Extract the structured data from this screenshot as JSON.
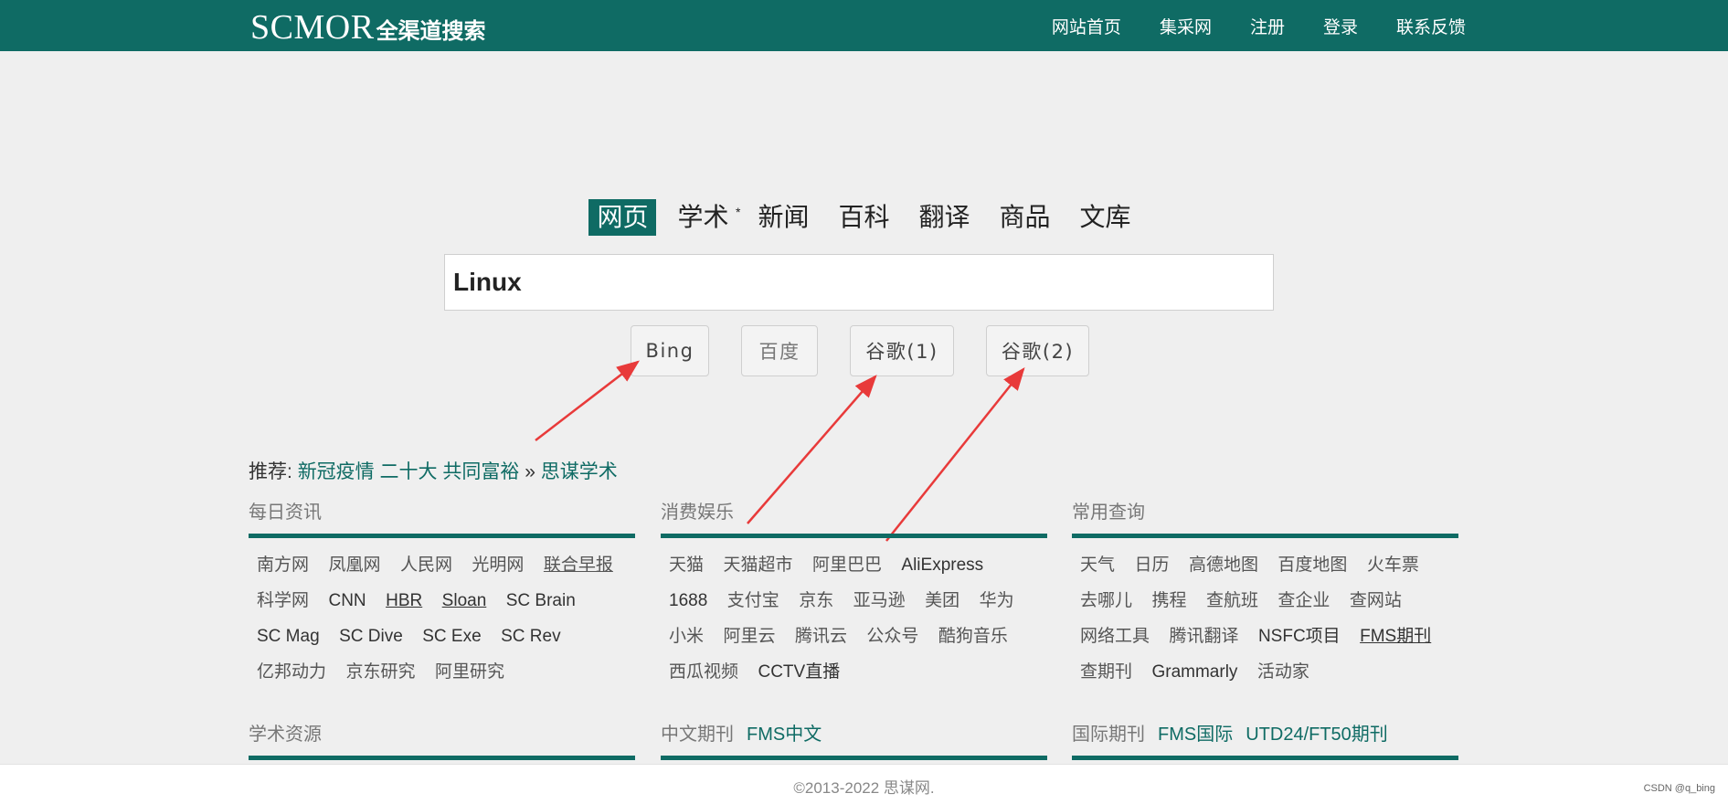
{
  "header": {
    "logo_en": "SCMOR",
    "logo_cn": "全渠道搜索",
    "nav": [
      "网站首页",
      "集采网",
      "注册",
      "登录",
      "联系反馈"
    ]
  },
  "tabs": [
    {
      "label": "网页",
      "active": true
    },
    {
      "label": "学术",
      "sup": "*"
    },
    {
      "label": "新闻"
    },
    {
      "label": "百科"
    },
    {
      "label": "翻译"
    },
    {
      "label": "商品"
    },
    {
      "label": "文库"
    }
  ],
  "search": {
    "value": "Linux"
  },
  "buttons": {
    "bing": "Bing",
    "baidu": "百度",
    "google1": "谷歌(1)",
    "google2": "谷歌(2)"
  },
  "recommend": {
    "prefix": "推荐:",
    "links": [
      "新冠疫情",
      "二十大",
      "共同富裕"
    ],
    "sep": "»",
    "more": "思谋学术"
  },
  "sections": {
    "daily": {
      "title": "每日资讯",
      "links": [
        "南方网",
        "凤凰网",
        "人民网",
        "光明网",
        "联合早报",
        "科学网",
        "CNN",
        "HBR",
        "Sloan",
        "SC Brain",
        "SC Mag",
        "SC Dive",
        "SC Exe",
        "SC Rev",
        "亿邦动力",
        "京东研究",
        "阿里研究"
      ]
    },
    "consumer": {
      "title": "消费娱乐",
      "links": [
        "天猫",
        "天猫超市",
        "阿里巴巴",
        "AliExpress",
        "1688",
        "支付宝",
        "京东",
        "亚马逊",
        "美团",
        "华为",
        "小米",
        "阿里云",
        "腾讯云",
        "公众号",
        "酷狗音乐",
        "西瓜视频",
        "CCTV直播"
      ]
    },
    "lookup": {
      "title": "常用查询",
      "links": [
        "天气",
        "日历",
        "高德地图",
        "百度地图",
        "火车票",
        "去哪儿",
        "携程",
        "查航班",
        "查企业",
        "查网站",
        "网络工具",
        "腾讯翻译",
        "NSFC项目",
        "FMS期刊",
        "查期刊",
        "Grammarly",
        "活动家"
      ]
    },
    "academic": {
      "title": "学术资源"
    },
    "cn_journals": {
      "title": "中文期刊",
      "link": "FMS中文"
    },
    "intl_journals": {
      "title": "国际期刊",
      "links": [
        "FMS国际",
        "UTD24/FT50期刊"
      ]
    }
  },
  "footer": {
    "copyright": "©2013-2022   思谋网.",
    "watermark": "CSDN @q_bing"
  },
  "colors": {
    "brand": "#0f6b64",
    "arrow": "#e83a3a",
    "background": "#efefef"
  }
}
